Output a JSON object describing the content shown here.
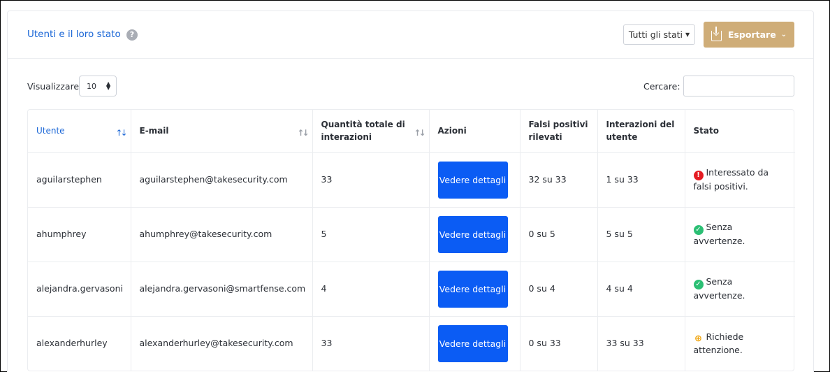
{
  "header": {
    "title": "Utenti e il loro stato",
    "help_icon": "?",
    "status_filter": "Tutti gli stati",
    "export_label": "Esportare"
  },
  "controls": {
    "show_label": "Visualizzare",
    "page_size": "10",
    "search_label": "Cercare:",
    "search_value": ""
  },
  "table": {
    "columns": [
      "Utente",
      "E-mail",
      "Quantità totale di interazioni",
      "Azioni",
      "Falsi positivi rilevati",
      "Interazioni del utente",
      "Stato"
    ],
    "rows": [
      {
        "user": "aguilarstephen",
        "email": "aguilarstephen@takesecurity.com",
        "total": "33",
        "action": "Vedere dettagli",
        "false_positives": "32 su 33",
        "user_interactions": "1 su 33",
        "status": "Interessato da falsi positivi.",
        "status_type": "red"
      },
      {
        "user": "ahumphrey",
        "email": "ahumphrey@takesecurity.com",
        "total": "5",
        "action": "Vedere dettagli",
        "false_positives": "0 su 5",
        "user_interactions": "5 su 5",
        "status": "Senza avvertenze.",
        "status_type": "green"
      },
      {
        "user": "alejandra.gervasoni",
        "email": "alejandra.gervasoni@smartfense.com",
        "total": "4",
        "action": "Vedere dettagli",
        "false_positives": "0 su 4",
        "user_interactions": "4 su 4",
        "status": "Senza avvertenze.",
        "status_type": "green"
      },
      {
        "user": "alexanderhurley",
        "email": "alexanderhurley@takesecurity.com",
        "total": "33",
        "action": "Vedere dettagli",
        "false_positives": "0 su 33",
        "user_interactions": "33 su 33",
        "status": "Richiede attenzione.",
        "status_type": "warn"
      }
    ]
  },
  "colors": {
    "accent": "#1a66d6",
    "primary_button": "#0b5cf4",
    "export_button": "#cfad78",
    "status_red": "#e51c23",
    "status_green": "#2bbf74",
    "status_warn": "#f0a30a"
  },
  "icons": {
    "status_red": "exclamation-circle-icon",
    "status_green": "check-circle-icon",
    "status_warn": "magnify-plus-icon"
  }
}
